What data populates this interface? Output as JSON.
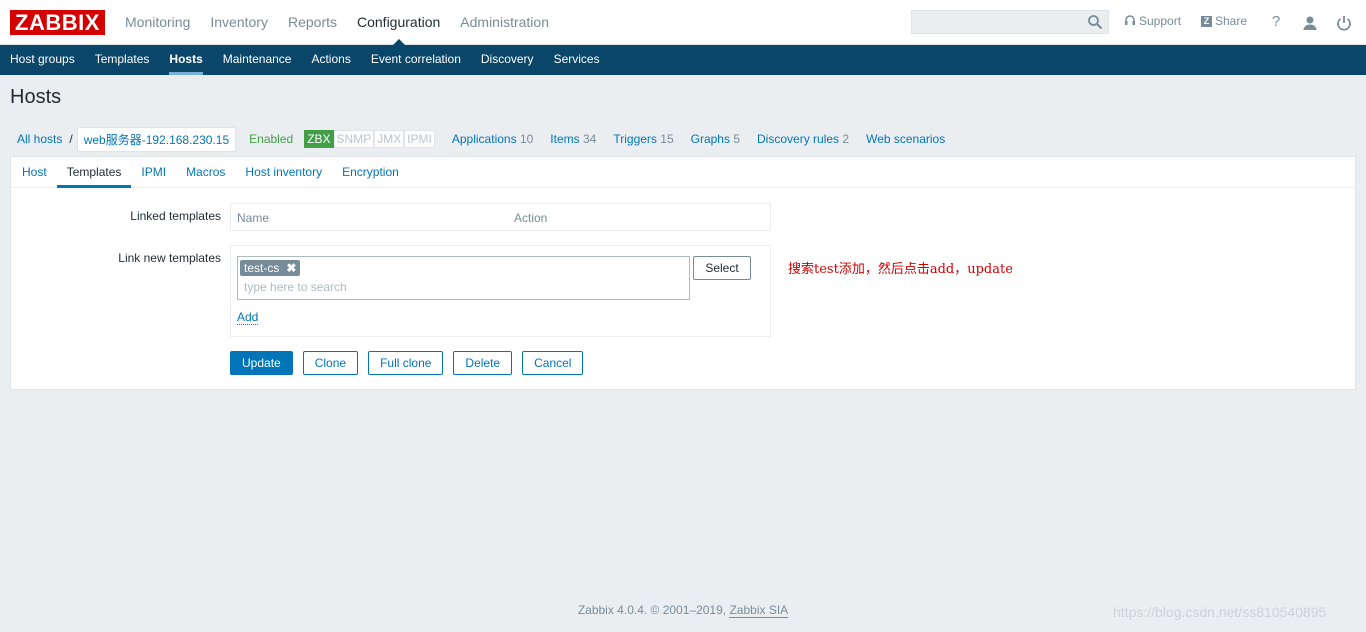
{
  "header": {
    "logo": "ZABBIX",
    "menu": [
      "Monitoring",
      "Inventory",
      "Reports",
      "Configuration",
      "Administration"
    ],
    "active_menu": "Configuration",
    "support_label": "Support",
    "share_label": "Share",
    "help_label": "?"
  },
  "submenu": {
    "items": [
      "Host groups",
      "Templates",
      "Hosts",
      "Maintenance",
      "Actions",
      "Event correlation",
      "Discovery",
      "Services"
    ],
    "active": "Hosts"
  },
  "page": {
    "title": "Hosts"
  },
  "hostnav": {
    "all_hosts": "All hosts",
    "separator": "/",
    "host_name": "web服务器-192.168.230.15",
    "status": "Enabled",
    "badges": [
      {
        "label": "ZBX",
        "on": true
      },
      {
        "label": "SNMP",
        "on": false
      },
      {
        "label": "JMX",
        "on": false
      },
      {
        "label": "IPMI",
        "on": false
      }
    ],
    "links": [
      {
        "label": "Applications",
        "count": "10"
      },
      {
        "label": "Items",
        "count": "34"
      },
      {
        "label": "Triggers",
        "count": "15"
      },
      {
        "label": "Graphs",
        "count": "5"
      },
      {
        "label": "Discovery rules",
        "count": "2"
      },
      {
        "label": "Web scenarios",
        "count": ""
      }
    ]
  },
  "tabs": {
    "items": [
      "Host",
      "Templates",
      "IPMI",
      "Macros",
      "Host inventory",
      "Encryption"
    ],
    "active": "Templates"
  },
  "form": {
    "linked_label": "Linked templates",
    "linked_columns": [
      "Name",
      "Action"
    ],
    "link_new_label": "Link new templates",
    "selected_template": "test-cs",
    "remove_glyph": "✖",
    "search_placeholder": "type here to search",
    "select_button": "Select",
    "add_link": "Add",
    "buttons": [
      "Update",
      "Clone",
      "Full clone",
      "Delete",
      "Cancel"
    ]
  },
  "annotation": "搜索test添加，然后点击add，update",
  "footer": {
    "text": "Zabbix 4.0.4. © 2001–2019,",
    "company": "Zabbix SIA"
  },
  "watermark": "https://blog.csdn.net/ss810540895",
  "colors": {
    "brand_red": "#d40000",
    "nav_blue": "#0a466a",
    "link_blue": "#0275b8",
    "enabled_green": "#429e47"
  }
}
